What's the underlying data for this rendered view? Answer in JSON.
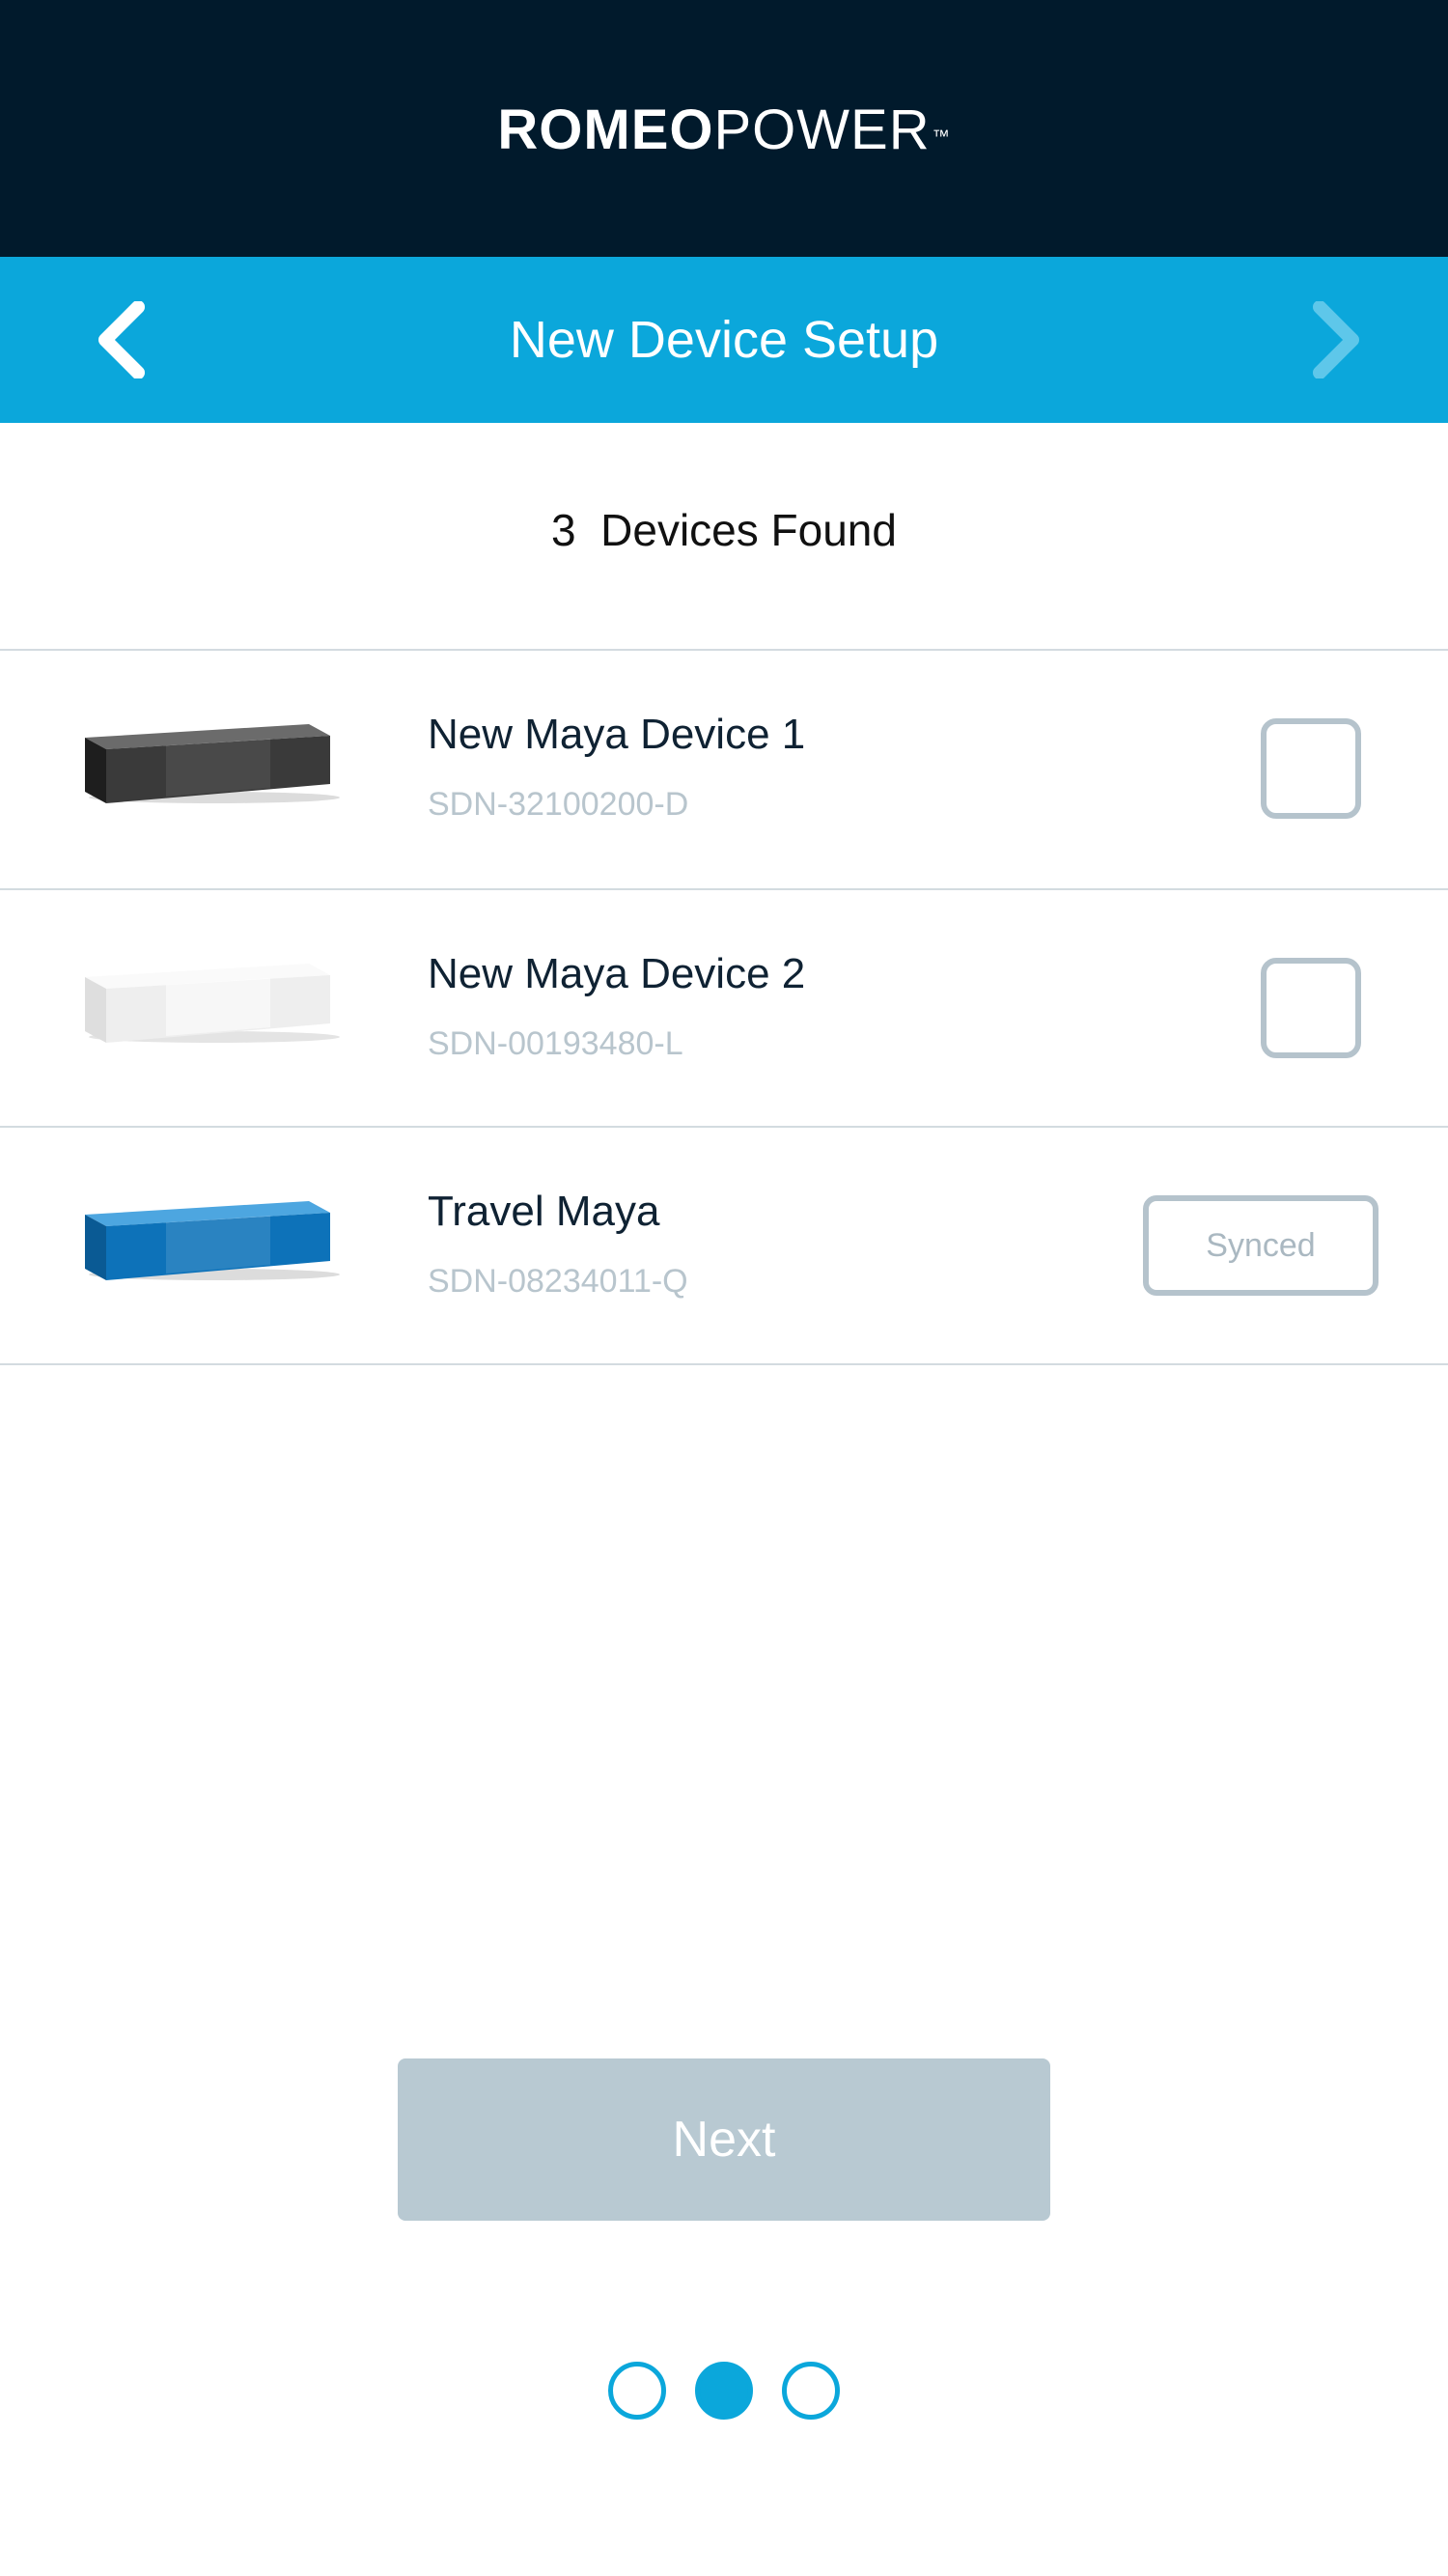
{
  "header": {
    "brand_bold": "ROMEO",
    "brand_light": "POWER",
    "brand_tm": "™"
  },
  "nav": {
    "title": "New Device Setup",
    "back_icon": "chevron-left-icon",
    "forward_icon": "chevron-right-icon"
  },
  "found_text": "3  Devices Found",
  "devices": [
    {
      "name": "New Maya Device 1",
      "serial": "SDN-32100200-D",
      "color": "#3a3a3a",
      "status": "unchecked"
    },
    {
      "name": "New Maya Device 2",
      "serial": "SDN-00193480-L",
      "color": "#ececec",
      "status": "unchecked"
    },
    {
      "name": "Travel Maya",
      "serial": "SDN-08234011-Q",
      "color": "#0d72b9",
      "status": "synced",
      "status_label": "Synced"
    }
  ],
  "next_button": {
    "label": "Next"
  },
  "pager": {
    "total": 3,
    "current": 2
  },
  "colors": {
    "header_bg": "#011a2c",
    "nav_bg": "#0ba7db",
    "accent": "#0ba7db",
    "disabled_button": "#b8c9d2"
  }
}
